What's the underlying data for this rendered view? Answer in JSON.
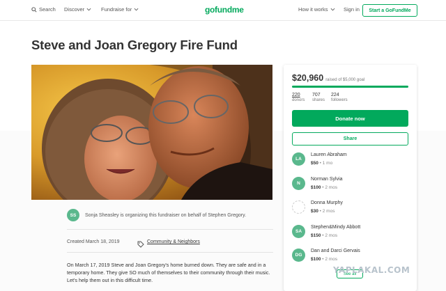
{
  "nav": {
    "search_label": "Search",
    "discover_label": "Discover",
    "fundraise_label": "Fundraise for",
    "logo": "gofundme",
    "how_it_works_label": "How it works",
    "sign_in_label": "Sign in",
    "cta_label": "Start a GoFundMe"
  },
  "campaign": {
    "title": "Steve and Joan Gregory Fire Fund",
    "organizer_initials": "SS",
    "organizer_text": "Sonja Sheasley is organizing this fundraiser on behalf of Stephen Gregory.",
    "created": "Created March 18, 2019",
    "category": "Community & Neighbors",
    "story": "On March 17, 2019 Steve and Joan Gregory's home burned down. They are safe and in a temporary home. They give SO much of themselves to their community through their music. Let's help them out in this difficult time."
  },
  "card": {
    "raised_amount": "$20,960",
    "raised_goal": "raised of $5,000 goal",
    "progress_fraction": 1.0,
    "stats": [
      {
        "num": "220",
        "label": "donors"
      },
      {
        "num": "707",
        "label": "shares"
      },
      {
        "num": "224",
        "label": "followers"
      }
    ],
    "donate_label": "Donate now",
    "share_label": "Share",
    "donors": [
      {
        "initials": "LA",
        "name": "Lauren Abraham",
        "amount": "$50",
        "time": "1 mo"
      },
      {
        "initials": "N",
        "name": "Norman Sylvia",
        "amount": "$100",
        "time": "2 mos"
      },
      {
        "initials": "",
        "name": "Donna Murphy",
        "amount": "$30",
        "time": "2 mos"
      },
      {
        "initials": "SA",
        "name": "Stephen&Mindy Abbott",
        "amount": "$150",
        "time": "2 mos"
      },
      {
        "initials": "DG",
        "name": "Dan and Darci Gervais",
        "amount": "$100",
        "time": "2 mos"
      }
    ],
    "see_all_label": "See all"
  },
  "watermark": "YAPLAKAL.COM",
  "colors": {
    "brand_green": "#02a95c",
    "avatar_green": "#5ab88d"
  }
}
